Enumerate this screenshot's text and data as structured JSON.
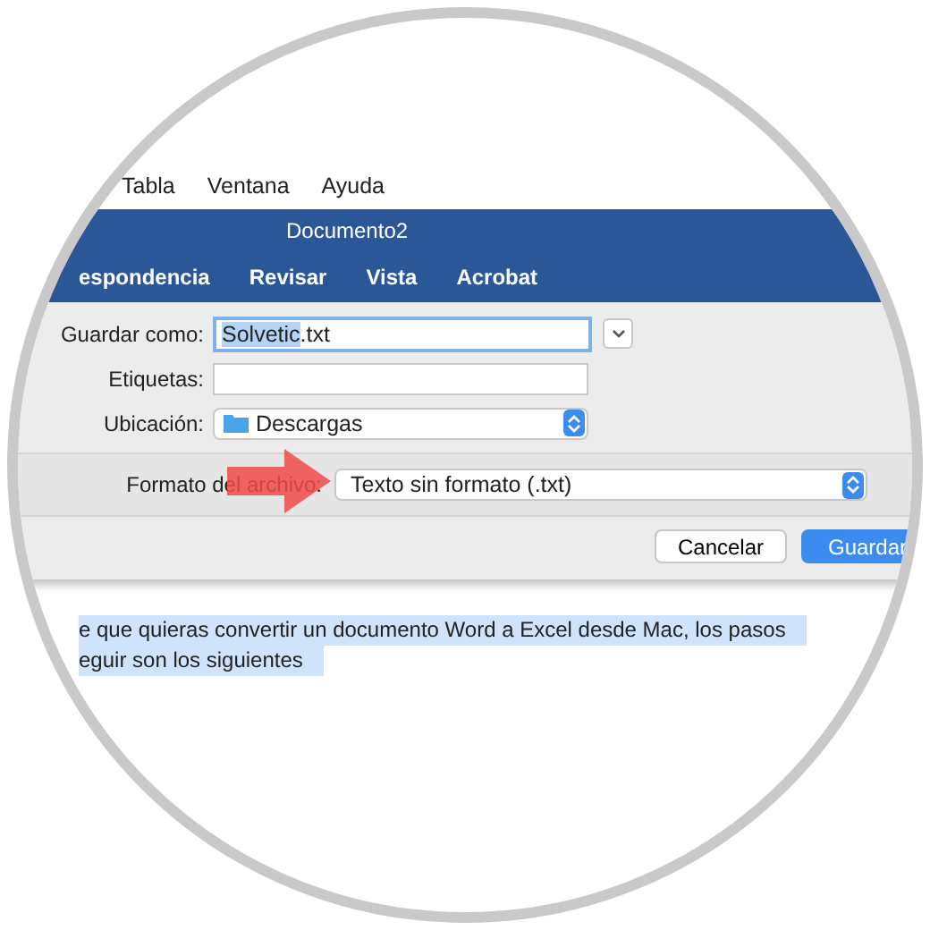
{
  "menu_bar": {
    "items": [
      "Tabla",
      "Ventana",
      "Ayuda"
    ]
  },
  "window": {
    "title": "Documento2"
  },
  "ribbon_tabs": [
    "espondencia",
    "Revisar",
    "Vista",
    "Acrobat"
  ],
  "save_dialog": {
    "fields": [
      {
        "kind": "text",
        "label": "Guardar como:",
        "value_selected": "Solvetic",
        "value_rest": ".txt",
        "focused": true
      },
      {
        "kind": "text",
        "label": "Etiquetas:",
        "focused": false
      },
      {
        "kind": "popup",
        "label": "Ubicación:",
        "value": "Descargas"
      }
    ],
    "format": {
      "label": "Formato del archivo:",
      "value": "Texto sin formato (.txt)"
    },
    "buttons": [
      {
        "label": "Cancelar",
        "kind": "default"
      },
      {
        "label": "Guardar",
        "kind": "primary"
      }
    ]
  },
  "document": {
    "selected": true,
    "lines": [
      "e que quieras convertir un documento Word a Excel desde Mac, los pasos",
      "eguir son los siguientes"
    ]
  }
}
